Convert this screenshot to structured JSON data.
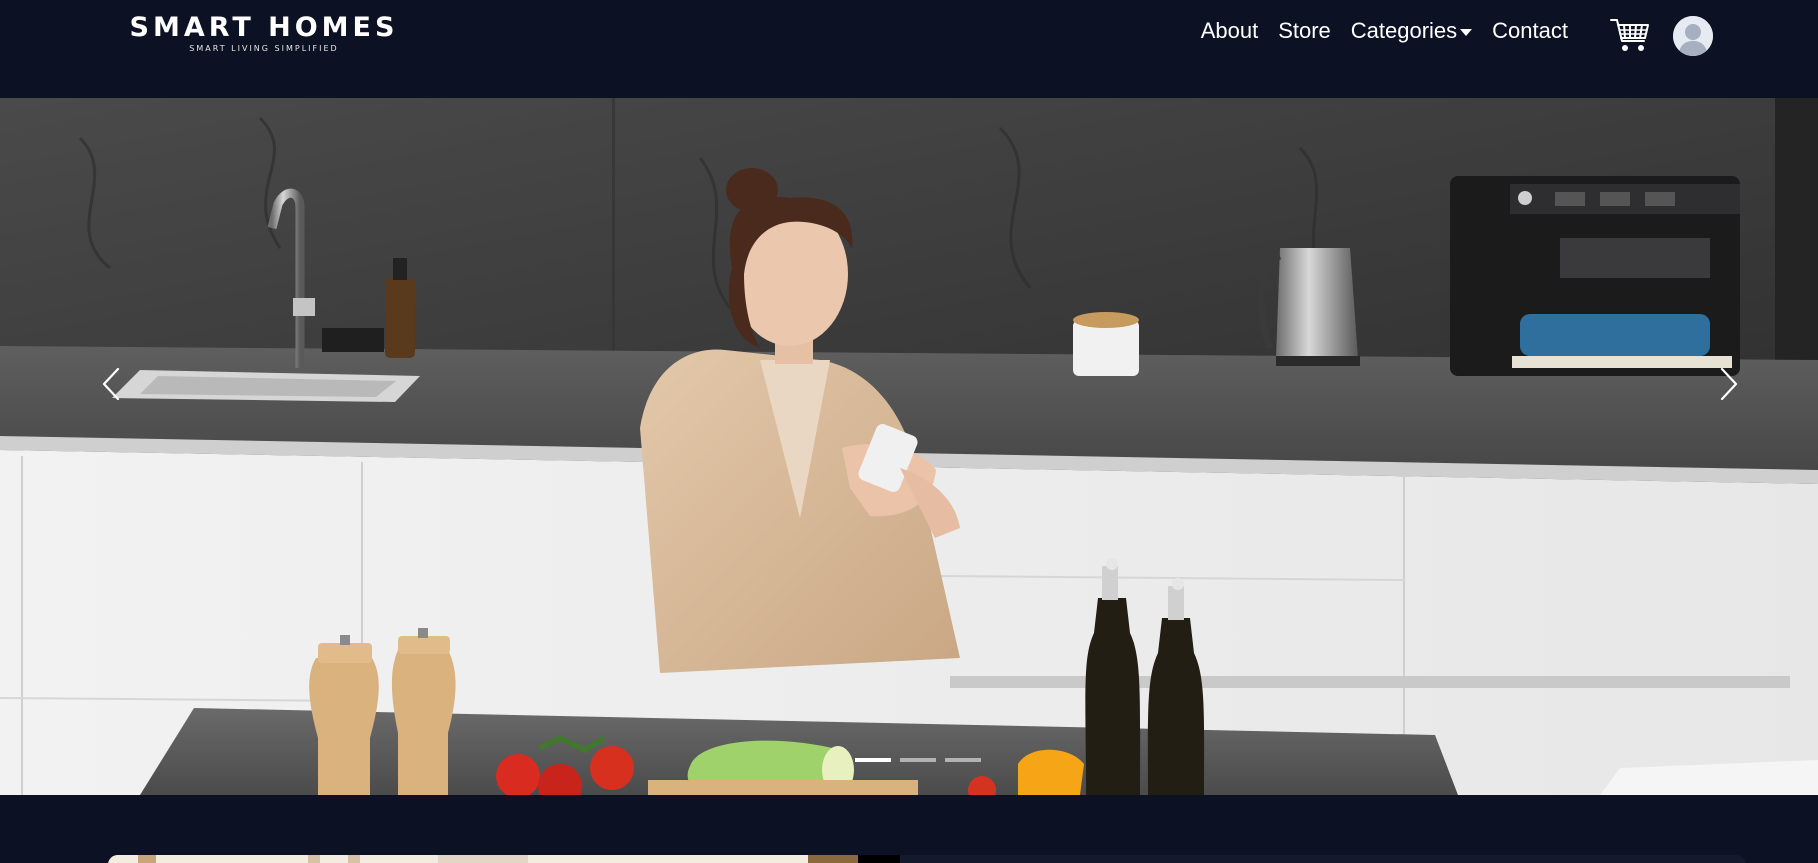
{
  "brand": {
    "title": "SMART HOMES",
    "tagline": "SMART LIVING SIMPLIFIED"
  },
  "nav": {
    "items": [
      {
        "label": "About"
      },
      {
        "label": "Store"
      },
      {
        "label": "Categories",
        "dropdown": true
      },
      {
        "label": "Contact"
      }
    ]
  },
  "icons": {
    "cart": "cart-icon",
    "profile": "user-avatar-icon",
    "prev": "chevron-left-icon",
    "next": "chevron-right-icon"
  },
  "carousel": {
    "slide_count": 3,
    "active_slide": 1
  },
  "colors": {
    "navbar": "#0c1224",
    "text": "#ffffff"
  }
}
